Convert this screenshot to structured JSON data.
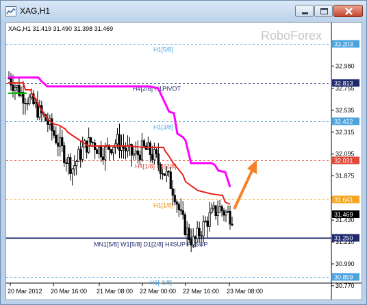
{
  "window": {
    "title": "XAG,H1",
    "controls": {
      "minimize_icon": "minimize-icon",
      "maximize_icon": "maximize-icon",
      "close_icon": "close-icon"
    }
  },
  "chart": {
    "info_line": "XAG,H1  31.419 31.490 31.398 31.469",
    "watermark": "RoboForex",
    "current_price": "31.469"
  },
  "chart_data": {
    "type": "candlestick",
    "symbol": "XAG",
    "timeframe": "H1",
    "ohlc": {
      "open": 31.419,
      "high": 31.49,
      "low": 31.398,
      "close": 31.469
    },
    "y_ticks": [
      "32.980",
      "32.755",
      "32.535",
      "32.315",
      "32.095",
      "31.875",
      "31.650",
      "31.430",
      "31.210",
      "30.990",
      "30.770"
    ],
    "x_ticks": [
      "20 Mar 2012",
      "20 Mar 16:00",
      "21 Mar 08:00",
      "22 Mar 00:00",
      "22 Mar 16:00",
      "23 Mar 08:00"
    ],
    "levels": [
      {
        "name": "H1[5/8]",
        "price": "33.203",
        "color": "#4aa3df",
        "style": "dashed"
      },
      {
        "name": "H4[2/8] H1PIVOT",
        "price": "32.813",
        "color": "#1f2a6e",
        "style": "dashed"
      },
      {
        "name": "H1[3/8]",
        "price": "32.422",
        "color": "#4aa3df",
        "style": "dashed"
      },
      {
        "name": "H4[1/8] H1[2/8]",
        "price": "32.031",
        "color": "#e0483a",
        "style": "dashed"
      },
      {
        "name": "H1[1/8]",
        "price": "31.641",
        "color": "#f5a623",
        "style": "dashed"
      },
      {
        "name": "MN1[5/8] W1[5/8] D1[2/8] H4SUP H1SUP",
        "price": "31.250",
        "color": "#1f2a6e",
        "style": "solid"
      },
      {
        "name": "H1[-1/8]",
        "price": "30.859",
        "color": "#4aa3df",
        "style": "dashed"
      }
    ],
    "price_series_approx": [
      32.86,
      32.78,
      32.7,
      32.65,
      32.58,
      32.5,
      32.42,
      32.3,
      32.18,
      32.05,
      31.95,
      32.08,
      32.18,
      32.22,
      32.15,
      32.12,
      32.18,
      32.22,
      32.16,
      32.1,
      32.08,
      32.15,
      32.12,
      32.05,
      31.95,
      31.85,
      31.7,
      31.45,
      31.3,
      31.2,
      31.32,
      31.42,
      31.5,
      31.55,
      31.5,
      31.47
    ],
    "indicator_lines": [
      {
        "name": "red-step-line",
        "color": "#e8201a"
      },
      {
        "name": "magenta-step-line",
        "color": "#ff00ff"
      },
      {
        "name": "green-segment",
        "color": "#00c000"
      }
    ],
    "annotation": {
      "type": "arrow",
      "direction": "up",
      "color": "#f5822a"
    }
  }
}
